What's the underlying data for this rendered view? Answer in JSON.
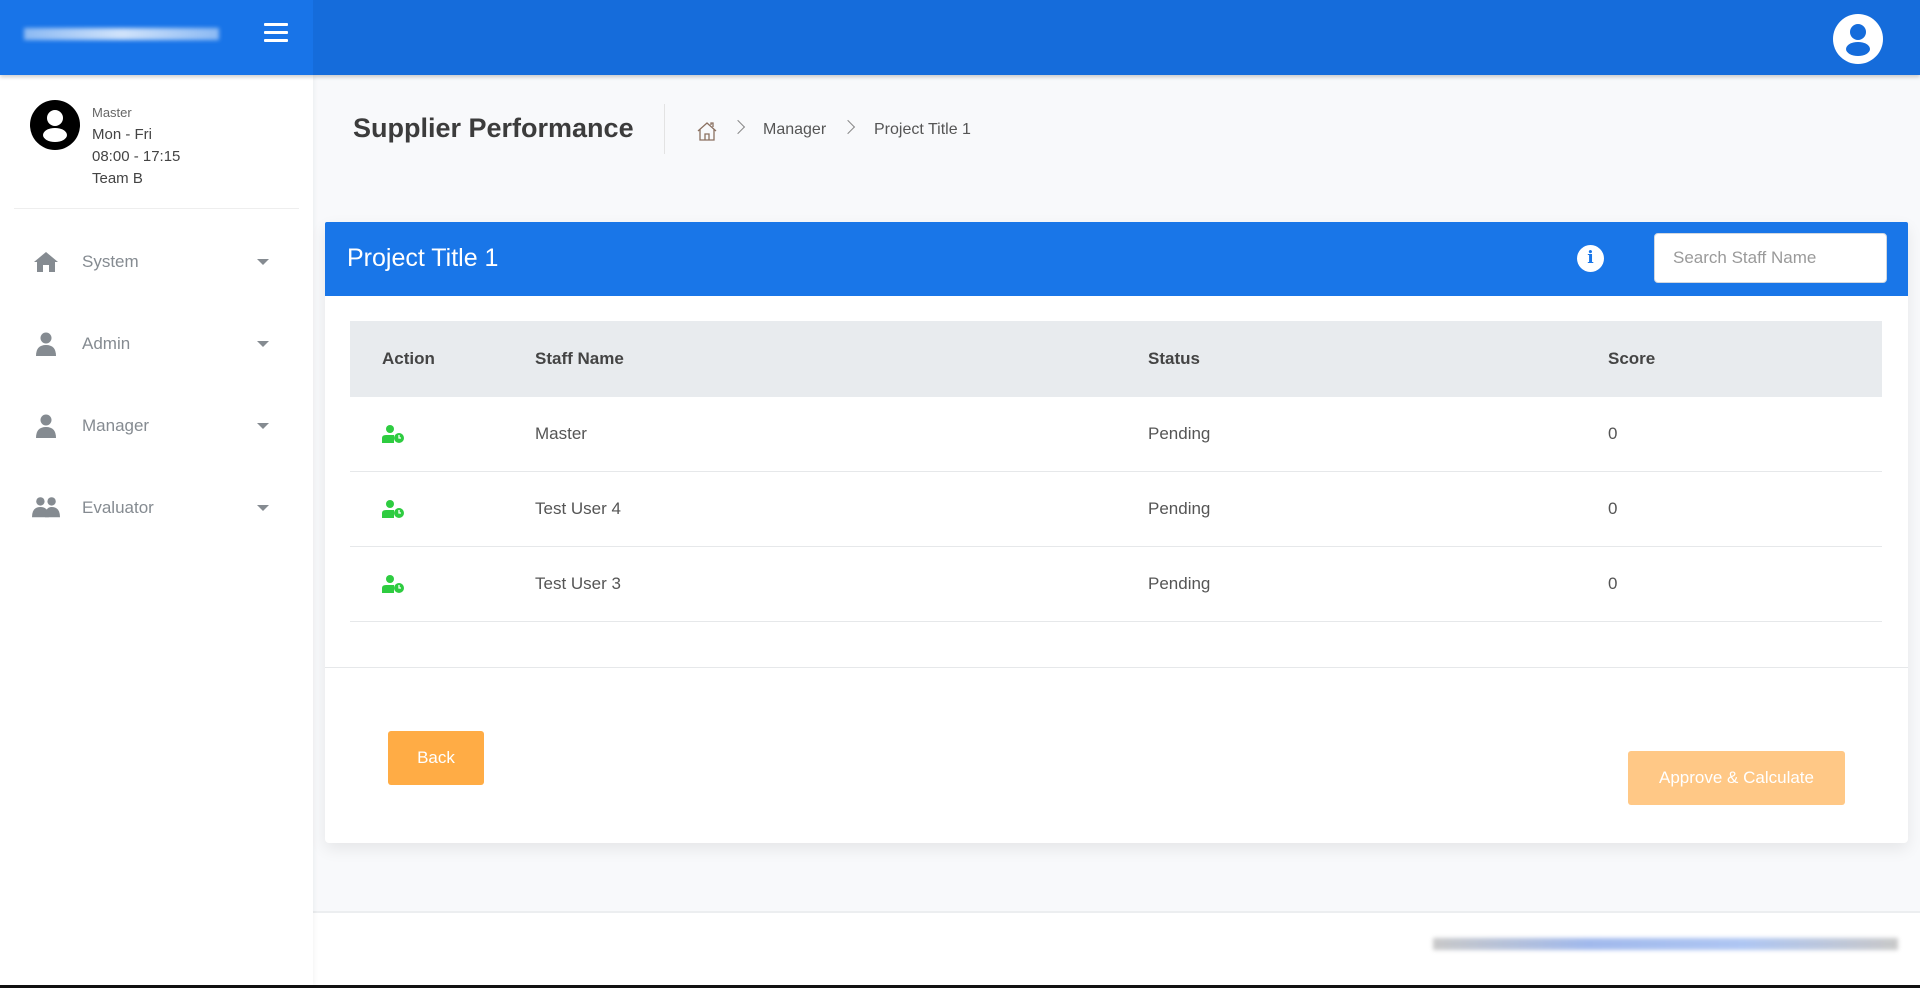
{
  "topbar": {
    "menu_icon": "hamburger-icon",
    "user_icon": "user-circle-icon"
  },
  "sidebar": {
    "profile": {
      "role": "Master",
      "days": "Mon - Fri",
      "hours": "08:00 - 17:15",
      "team": "Team B"
    },
    "items": [
      {
        "label": "System",
        "icon": "home-icon"
      },
      {
        "label": "Admin",
        "icon": "user-icon"
      },
      {
        "label": "Manager",
        "icon": "user-icon"
      },
      {
        "label": "Evaluator",
        "icon": "users-icon"
      }
    ]
  },
  "page": {
    "title": "Supplier Performance",
    "breadcrumb": [
      "Manager",
      "Project Title 1"
    ]
  },
  "card": {
    "title": "Project Title 1",
    "info_label": "i",
    "search_placeholder": "Search Staff Name",
    "columns": [
      "Action",
      "Staff Name",
      "Status",
      "Score"
    ],
    "rows": [
      {
        "name": "Master",
        "status": "Pending",
        "score": "0"
      },
      {
        "name": "Test User 4",
        "status": "Pending",
        "score": "0"
      },
      {
        "name": "Test User 3",
        "status": "Pending",
        "score": "0"
      }
    ],
    "back_label": "Back",
    "approve_label": "Approve & Calculate"
  },
  "colors": {
    "primary": "#1976e8",
    "topbar": "#156cdb",
    "action_green": "#2ecc40",
    "back": "#ffac45",
    "approve_disabled": "#ffc886"
  }
}
